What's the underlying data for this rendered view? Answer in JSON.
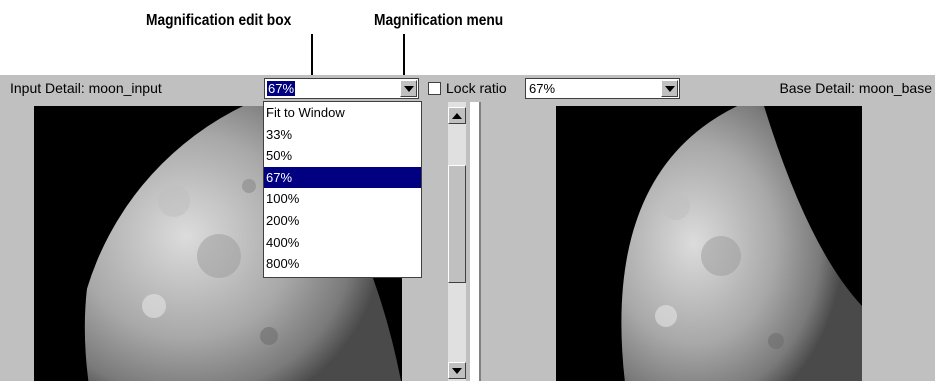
{
  "callouts": {
    "edit_box": "Magnification edit box",
    "menu": "Magnification menu"
  },
  "toolbar": {
    "input_detail_label": "Input Detail: moon_input",
    "left_magnification_value": "67%",
    "lock_ratio_label": "Lock ratio",
    "lock_ratio_checked": false,
    "right_magnification_value": "67%",
    "base_detail_label": "Base Detail: moon_base"
  },
  "magnification_menu": {
    "options": [
      "Fit to Window",
      "33%",
      "50%",
      "67%",
      "100%",
      "200%",
      "400%",
      "800%"
    ],
    "selected": "67%"
  },
  "colors": {
    "selection": "#000080",
    "panel_gray": "#c0c0c0"
  }
}
